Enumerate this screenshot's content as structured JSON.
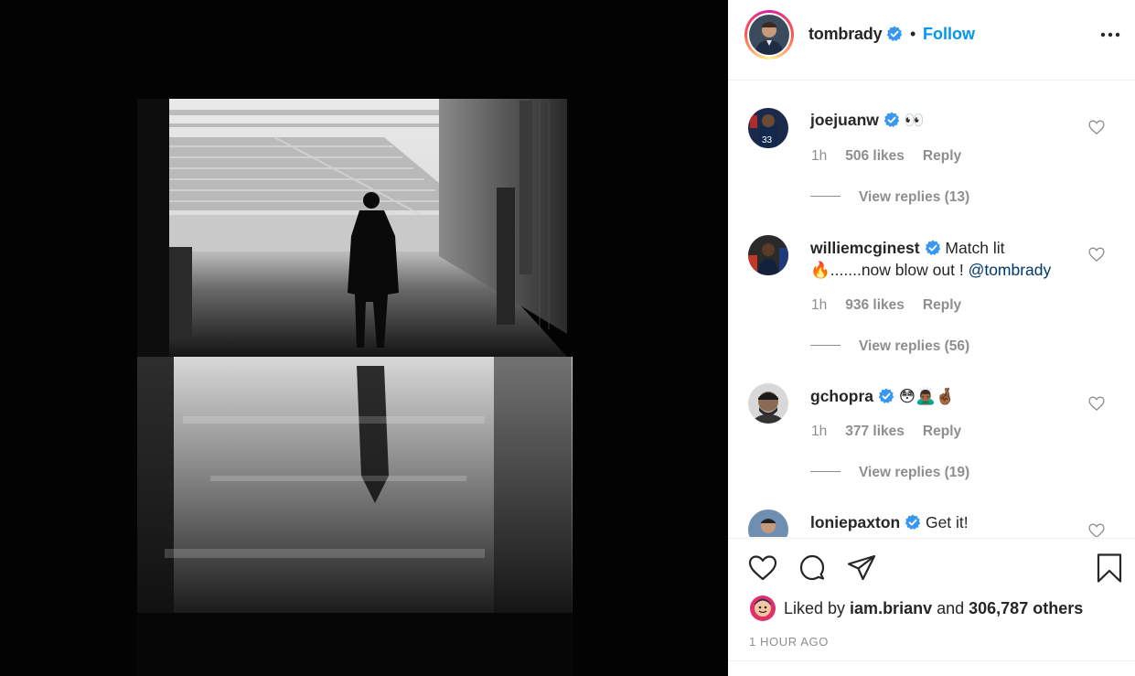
{
  "post": {
    "author": "tombrady",
    "separator": "•",
    "follow_label": "Follow",
    "more_icon": "more-options-icon"
  },
  "comments": [
    {
      "user": "joejuanw",
      "text": "👀",
      "time": "1h",
      "likes": "506 likes",
      "reply_label": "Reply",
      "view_replies": "View replies (13)"
    },
    {
      "user": "williemcginest",
      "text_a": "Match lit",
      "text_b": "🔥.......now blow out ! ",
      "mention": "@tombrady",
      "time": "1h",
      "likes": "936 likes",
      "reply_label": "Reply",
      "view_replies": "View replies (56)"
    },
    {
      "user": "gchopra",
      "text": "😳🙇🏾‍♂️🤞🏾",
      "time": "1h",
      "likes": "377 likes",
      "reply_label": "Reply",
      "view_replies": "View replies (19)"
    },
    {
      "user": "loniepaxton",
      "text": "Get it!"
    }
  ],
  "actions": {
    "like_icon": "heart-icon",
    "comment_icon": "comment-icon",
    "share_icon": "share-icon",
    "save_icon": "bookmark-icon"
  },
  "liked_by": {
    "prefix": "Liked by ",
    "user": "iam.brianv",
    "middle": " and ",
    "count": "306,787 others"
  },
  "timestamp": "1 HOUR AGO",
  "colors": {
    "link": "#0095f6",
    "mention": "#00376b",
    "muted": "#8e8e8e",
    "text": "#262626"
  }
}
